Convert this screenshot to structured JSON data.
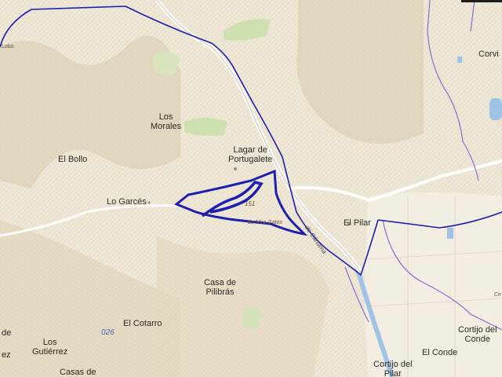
{
  "places": [
    {
      "id": "lobo",
      "text": "Lobo"
    },
    {
      "id": "corvi",
      "text": "Corvi"
    },
    {
      "id": "los-morales",
      "text": "Los\nMorales"
    },
    {
      "id": "lagar",
      "text": "Lagar de\nPortugalete"
    },
    {
      "id": "el-bollo",
      "text": "El Bollo"
    },
    {
      "id": "lo-garces",
      "text": "Lo Garcés"
    },
    {
      "id": "el-pilar",
      "text": "El Pilar"
    },
    {
      "id": "casa-pilibras",
      "text": "Casa de\nPilibrás"
    },
    {
      "id": "el-cotarro",
      "text": "El Cotarro"
    },
    {
      "id": "los-gutierrez",
      "text": "Los\nGutiérrez"
    },
    {
      "id": "casas-de",
      "text": "Casas de"
    },
    {
      "id": "cortijo-conde",
      "text": "Cortijo del\nConde"
    },
    {
      "id": "el-conde",
      "text": "El Conde"
    },
    {
      "id": "cortijo-pilar",
      "text": "Cortijo del\nPilar"
    },
    {
      "id": "edge-de",
      "text": "de"
    },
    {
      "id": "edge-ez",
      "text": "ez"
    },
    {
      "id": "edge-ce",
      "text": "Ce"
    }
  ],
  "annotations": {
    "parcel_number": "151",
    "arroyo": "de Mira Gatos",
    "road_code": "026",
    "road_name": "de Cártama"
  },
  "colors": {
    "terrain": "#efe7d6",
    "boundary": "#1c1fb0",
    "municipal_line": "#8a6bd8",
    "river": "#9fc3e6",
    "vegetation": "#cfe0b0"
  }
}
